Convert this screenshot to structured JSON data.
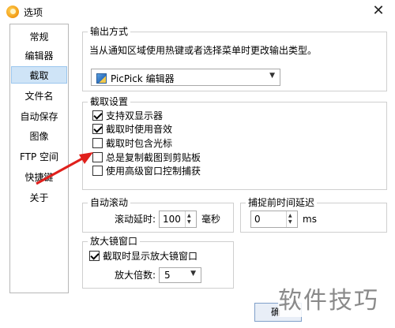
{
  "window": {
    "title": "选项",
    "close_glyph": "✕"
  },
  "sidebar": {
    "items": [
      {
        "label": "常规",
        "selected": false
      },
      {
        "label": "编辑器",
        "selected": false
      },
      {
        "label": "截取",
        "selected": true
      },
      {
        "label": "文件名",
        "selected": false
      },
      {
        "label": "自动保存",
        "selected": false
      },
      {
        "label": "图像",
        "selected": false
      },
      {
        "label": "FTP 空间",
        "selected": false
      },
      {
        "label": "快捷键",
        "selected": false
      },
      {
        "label": "关于",
        "selected": false
      }
    ]
  },
  "output": {
    "title": "输出方式",
    "description": "当从通知区域使用热键或者选择菜单时更改输出类型。",
    "select_value": "PicPick 编辑器",
    "select_icon": "picpick-icon"
  },
  "capture": {
    "title": "截取设置",
    "options": [
      {
        "label": "支持双显示器",
        "checked": true
      },
      {
        "label": "截取时使用音效",
        "checked": true
      },
      {
        "label": "截取时包含光标",
        "checked": false
      },
      {
        "label": "总是复制截图到剪贴板",
        "checked": false
      },
      {
        "label": "使用高级窗口控制捕获",
        "checked": false
      }
    ]
  },
  "autoscroll": {
    "title": "自动滚动",
    "delay_label": "滚动延时:",
    "delay_value": "100",
    "delay_unit": "毫秒"
  },
  "capture_delay": {
    "title": "捕捉前时间延迟",
    "value": "0",
    "unit": "ms"
  },
  "magnifier": {
    "title": "放大镜窗口",
    "show_label": "截取时显示放大镜窗口",
    "show_checked": true,
    "zoom_label": "放大倍数:",
    "zoom_value": "5"
  },
  "footer": {
    "button_label": "确"
  },
  "watermark": {
    "text": "软件技巧"
  },
  "colors": {
    "selection": "#cfe4f7",
    "arrow": "#e0201c"
  }
}
